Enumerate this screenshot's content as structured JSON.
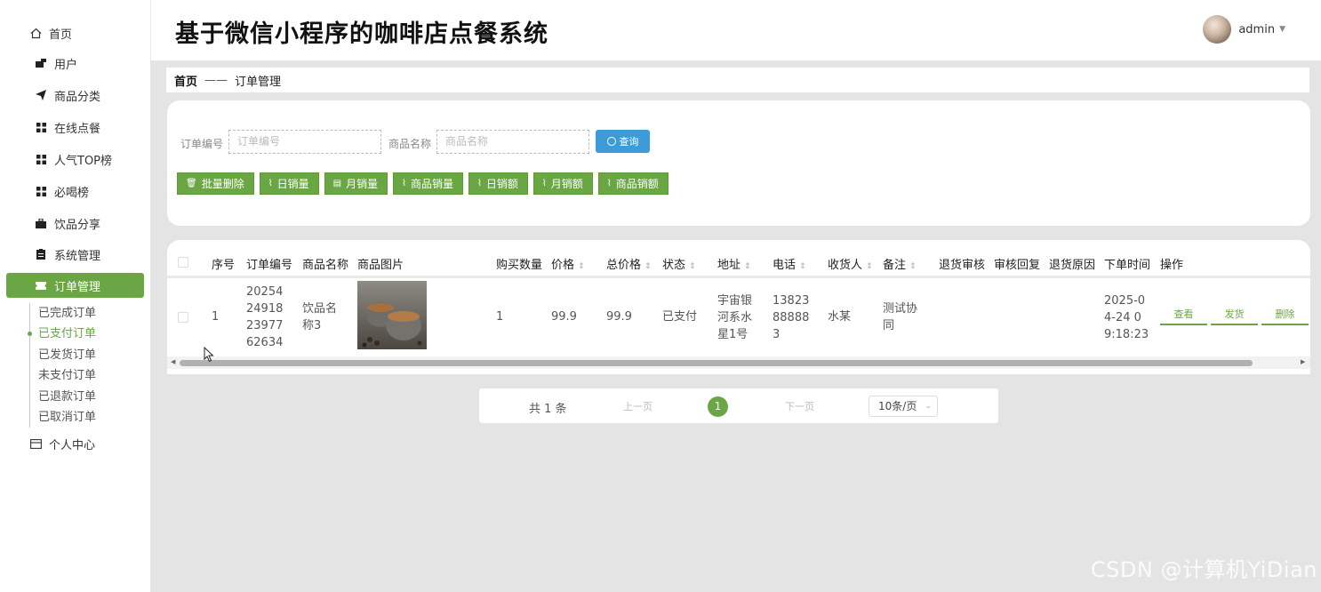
{
  "app_title": "基于微信小程序的咖啡店点餐系统",
  "user": {
    "name": "admin"
  },
  "sidebar": {
    "home": "首页",
    "items": [
      {
        "label": "用户",
        "icon": "user-card-icon"
      },
      {
        "label": "商品分类",
        "icon": "send-icon"
      },
      {
        "label": "在线点餐",
        "icon": "grid-icon"
      },
      {
        "label": "人气TOP榜",
        "icon": "grid-icon"
      },
      {
        "label": "必喝榜",
        "icon": "grid-icon"
      },
      {
        "label": "饮品分享",
        "icon": "briefcase-icon"
      },
      {
        "label": "系统管理",
        "icon": "clipboard-icon"
      },
      {
        "label": "订单管理",
        "icon": "ticket-icon"
      }
    ],
    "submenu": [
      "已完成订单",
      "已支付订单",
      "已发货订单",
      "未支付订单",
      "已退款订单",
      "已取消订单"
    ],
    "active_submenu": "已支付订单",
    "personal_center": "个人中心"
  },
  "breadcrumb": {
    "home": "首页",
    "separator": "——",
    "current": "订单管理"
  },
  "search": {
    "order_no_label": "订单编号",
    "order_no_placeholder": "订单编号",
    "product_name_label": "商品名称",
    "product_name_placeholder": "商品名称",
    "query_button": "查询"
  },
  "toolbar": {
    "batch_delete": "批量删除",
    "daily_sales_volume": "日销量",
    "monthly_sales_volume": "月销量",
    "product_sales_volume": "商品销量",
    "daily_revenue": "日销额",
    "monthly_revenue": "月销额",
    "product_revenue": "商品销额"
  },
  "table": {
    "headers": {
      "index": "序号",
      "order_no": "订单编号",
      "product_name": "商品名称",
      "product_image": "商品图片",
      "quantity": "购买数量",
      "price": "价格",
      "total": "总价格",
      "status": "状态",
      "address": "地址",
      "phone": "电话",
      "receiver": "收货人",
      "remark": "备注",
      "refund_review": "退货审核",
      "review_reply": "审核回复",
      "refund_reason": "退货原因",
      "order_time": "下单时间",
      "actions": "操作"
    },
    "rows": [
      {
        "index": "1",
        "order_no": "2025424918239776263 4",
        "order_no_lines": [
          "20254",
          "24918",
          "23977",
          "62634"
        ],
        "product_name_lines": [
          "饮品名",
          "称3"
        ],
        "quantity": "1",
        "price": "99.9",
        "total": "99.9",
        "status": "已支付",
        "address_lines": [
          "宇宙银",
          "河系水",
          "星1号"
        ],
        "phone_lines": [
          "13823",
          "88888",
          "3"
        ],
        "receiver": "水某",
        "remark_lines": [
          "测试协",
          "同"
        ],
        "order_time_lines": [
          "2025-0",
          "4-24 0",
          "9:18:23"
        ],
        "actions": {
          "view": "查看",
          "ship": "发货",
          "delete": "删除"
        }
      }
    ]
  },
  "pagination": {
    "total": "共 1 条",
    "prev": "上一页",
    "current_page": "1",
    "next": "下一页",
    "page_size": "10条/页"
  },
  "watermark": "CSDN @计算机YiDian",
  "colors": {
    "primary_green": "#6aa744",
    "query_blue": "#3d9bd8",
    "background": "#e4e4e4"
  }
}
